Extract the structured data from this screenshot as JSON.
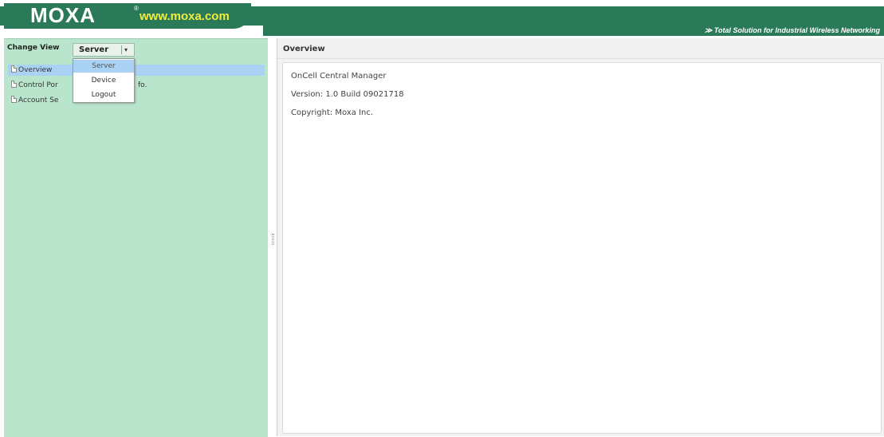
{
  "header": {
    "logo": "MOXA",
    "logo_registered": "®",
    "url": "www.moxa.com",
    "tagline": "≫ Total Solution for Industrial Wireless Networking",
    "brand_color": "#2a7a5a",
    "url_color": "#f2ec3c"
  },
  "sidebar": {
    "change_view_label": "Change View",
    "view_select": {
      "value": "Server",
      "arrow": "▾"
    },
    "tree": [
      {
        "label": "Overview",
        "selected": true
      },
      {
        "label": "Control Por",
        "suffix": "fo."
      },
      {
        "label": "Account Se"
      }
    ],
    "background": "#b9e5cc"
  },
  "view_menu": {
    "items": [
      {
        "label": "Server",
        "highlighted": true
      },
      {
        "label": "Device"
      },
      {
        "label": "Logout"
      }
    ]
  },
  "main": {
    "title": "Overview",
    "product": "OnCell Central Manager",
    "version": "Version: 1.0 Build 09021718",
    "copyright": "Copyright: Moxa Inc."
  }
}
